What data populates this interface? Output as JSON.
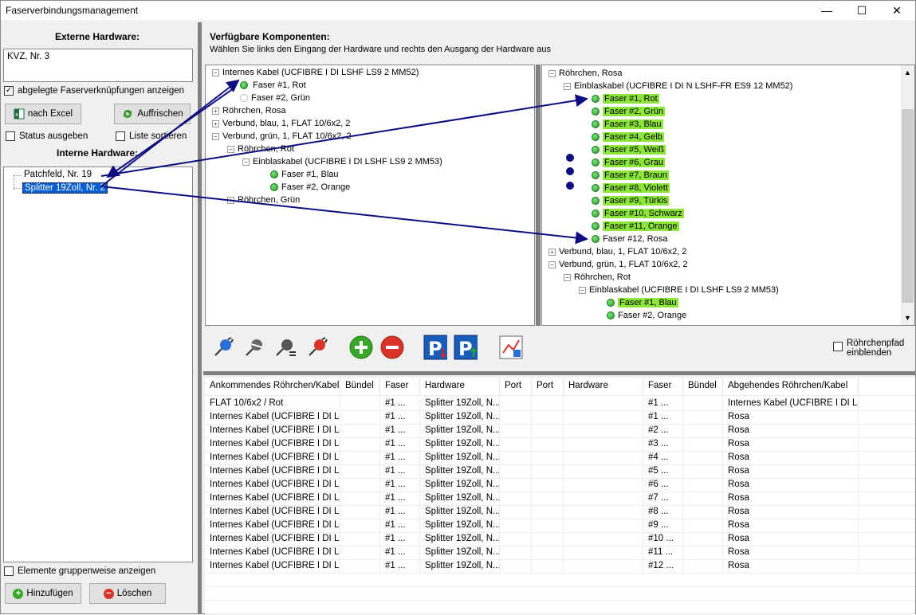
{
  "window": {
    "title": "Faserverbindungsmanagement",
    "minimize": "—",
    "maximize": "☐",
    "close": "✕"
  },
  "left": {
    "external_title": "Externe Hardware:",
    "external_value": "KVZ, Nr. 3",
    "show_stored_label": "abgelegte Faserverknüpfungen anzeigen",
    "excel_button": "nach Excel",
    "refresh_button": "Auffrischen",
    "status_label": "Status ausgeben",
    "sort_label": "Liste sortieren",
    "internal_title": "Interne Hardware:",
    "internal_items": [
      "Patchfeld, Nr. 19",
      "Splitter 19Zoll, Nr. 2"
    ],
    "group_label": "Elemente gruppenweise anzeigen",
    "add_button": "Hinzufügen",
    "delete_button": "Löschen"
  },
  "main": {
    "title": "Verfügbare Komponenten:",
    "subtitle": "Wählen Sie links den Eingang der Hardware und rechts den Ausgang der Hardware aus",
    "left_tree": [
      "Internes Kabel (UCFIBRE I DI LSHF LS9 2 MM52)",
      "Faser #1, Rot",
      "Faser #2, Grün",
      "Röhrchen, Rosa",
      "Verbund, blau, 1, FLAT 10/6x2, 2",
      "Verbund, grün, 1, FLAT 10/6x2, 2",
      "Röhrchen, Rot",
      "Einblaskabel (UCFIBRE I DI LSHF LS9 2 MM53)",
      "Faser #1, Blau",
      "Faser #2, Orange",
      "Röhrchen, Grün"
    ],
    "right_tree": [
      "Röhrchen, Rosa",
      "Einblaskabel (UCFIBRE I DI N LSHF-FR ES9 12 MM52)",
      "Faser #1, Rot",
      "Faser #2, Grün",
      "Faser #3, Blau",
      "Faser #4, Gelb",
      "Faser #5, Weiß",
      "Faser #6, Grau",
      "Faser #7, Braun",
      "Faser #8, Violett",
      "Faser #9, Türkis",
      "Faser #10, Schwarz",
      "Faser #11, Orange",
      "Faser #12, Rosa",
      "Verbund, blau, 1, FLAT 10/6x2, 2",
      "Verbund, grün, 1, FLAT 10/6x2, 2",
      "Röhrchen, Rot",
      "Einblaskabel (UCFIBRE I DI LSHF LS9 2 MM53)",
      "Faser #1, Blau",
      "Faser #2, Orange"
    ],
    "roehrchenpfad_label_1": "Röhrchenpfad",
    "roehrchenpfad_label_2": "einblenden"
  },
  "grid": {
    "columns": [
      "Ankommendes Röhrchen/Kabel",
      "Bündel",
      "Faser",
      "Hardware",
      "Port",
      "Port",
      "Hardware",
      "Faser",
      "Bündel",
      "Abgehendes Röhrchen/Kabel"
    ],
    "rows": [
      [
        "FLAT 10/6x2 / Rot",
        "",
        "#1 ...",
        "Splitter 19Zoll, N...",
        "",
        "",
        "",
        "#1 ...",
        "",
        "Internes Kabel (UCFIBRE I DI L..."
      ],
      [
        "Internes Kabel (UCFIBRE I DI L...",
        "",
        "#1 ...",
        "Splitter 19Zoll, N...",
        "",
        "",
        "",
        "#1 ...",
        "",
        "Rosa"
      ],
      [
        "Internes Kabel (UCFIBRE I DI L...",
        "",
        "#1 ...",
        "Splitter 19Zoll, N...",
        "",
        "",
        "",
        "#2 ...",
        "",
        "Rosa"
      ],
      [
        "Internes Kabel (UCFIBRE I DI L...",
        "",
        "#1 ...",
        "Splitter 19Zoll, N...",
        "",
        "",
        "",
        "#3 ...",
        "",
        "Rosa"
      ],
      [
        "Internes Kabel (UCFIBRE I DI L...",
        "",
        "#1 ...",
        "Splitter 19Zoll, N...",
        "",
        "",
        "",
        "#4 ...",
        "",
        "Rosa"
      ],
      [
        "Internes Kabel (UCFIBRE I DI L...",
        "",
        "#1 ...",
        "Splitter 19Zoll, N...",
        "",
        "",
        "",
        "#5 ...",
        "",
        "Rosa"
      ],
      [
        "Internes Kabel (UCFIBRE I DI L...",
        "",
        "#1 ...",
        "Splitter 19Zoll, N...",
        "",
        "",
        "",
        "#6 ...",
        "",
        "Rosa"
      ],
      [
        "Internes Kabel (UCFIBRE I DI L...",
        "",
        "#1 ...",
        "Splitter 19Zoll, N...",
        "",
        "",
        "",
        "#7 ...",
        "",
        "Rosa"
      ],
      [
        "Internes Kabel (UCFIBRE I DI L...",
        "",
        "#1 ...",
        "Splitter 19Zoll, N...",
        "",
        "",
        "",
        "#8 ...",
        "",
        "Rosa"
      ],
      [
        "Internes Kabel (UCFIBRE I DI L...",
        "",
        "#1 ...",
        "Splitter 19Zoll, N...",
        "",
        "",
        "",
        "#9 ...",
        "",
        "Rosa"
      ],
      [
        "Internes Kabel (UCFIBRE I DI L...",
        "",
        "#1 ...",
        "Splitter 19Zoll, N...",
        "",
        "",
        "",
        "#10 ...",
        "",
        "Rosa"
      ],
      [
        "Internes Kabel (UCFIBRE I DI L...",
        "",
        "#1 ...",
        "Splitter 19Zoll, N...",
        "",
        "",
        "",
        "#11 ...",
        "",
        "Rosa"
      ],
      [
        "Internes Kabel (UCFIBRE I DI L...",
        "",
        "#1 ...",
        "Splitter 19Zoll, N...",
        "",
        "",
        "",
        "#12 ...",
        "",
        "Rosa"
      ]
    ]
  },
  "colors": {
    "highlight": "#8ce63a",
    "selection": "#0a5fd0",
    "arrow": "#0d0d80"
  }
}
